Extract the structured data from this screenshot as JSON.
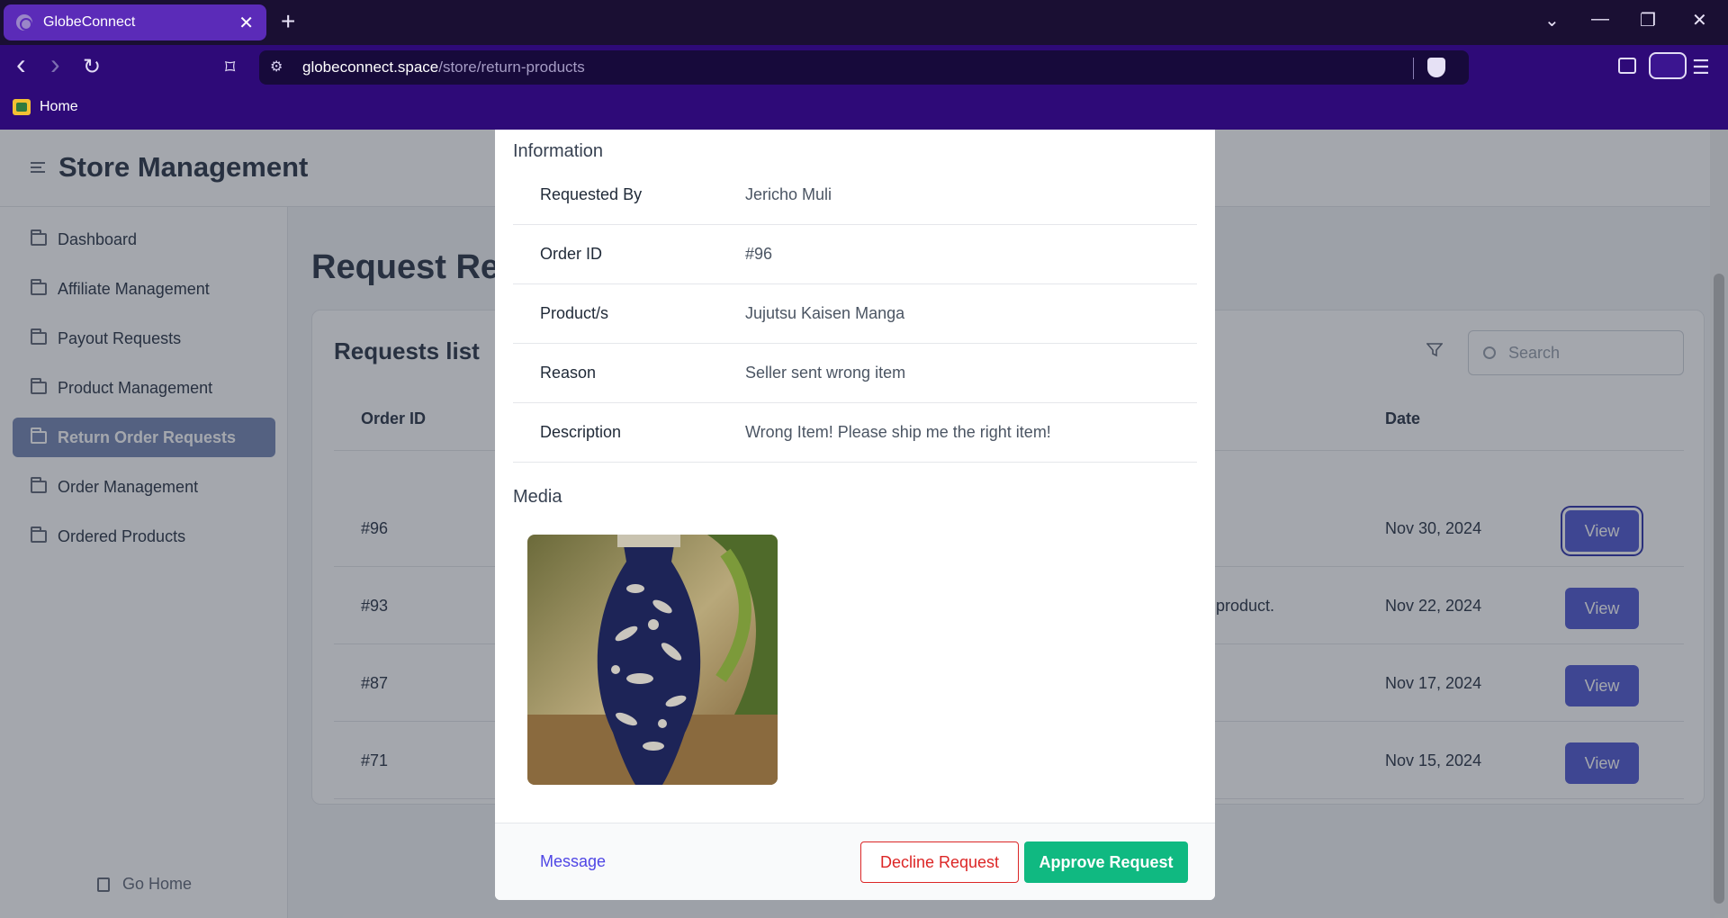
{
  "browser": {
    "tab_title": "GlobeConnect",
    "tab_close": "✕",
    "new_tab": "+",
    "url_host": "globeconnect.space",
    "url_path": "/store/return-products",
    "bookmark_home": "Home",
    "win_dropdown": "⌄",
    "win_minimize": "—",
    "win_restore": "❐",
    "win_close": "✕",
    "nav_back": "‹",
    "nav_forward": "›",
    "nav_reload": "↻",
    "bookmark_icon": "⌑",
    "menu_icon": "☰"
  },
  "app": {
    "title": "Store Management",
    "page_title": "Request Ret",
    "sidebar": {
      "items": [
        {
          "label": "Dashboard"
        },
        {
          "label": "Affiliate Management"
        },
        {
          "label": "Payout Requests"
        },
        {
          "label": "Product Management"
        },
        {
          "label": "Return Order Requests",
          "active": true
        },
        {
          "label": "Order Management"
        },
        {
          "label": "Ordered Products"
        }
      ],
      "go_home": "Go Home"
    },
    "requests_card": {
      "title": "Requests list",
      "search_placeholder": "Search",
      "columns": {
        "order_id": "Order ID",
        "date": "Date"
      },
      "rows": [
        {
          "order_id": "#96",
          "partial": "",
          "date": "Nov 30, 2024",
          "action": "View"
        },
        {
          "order_id": "#93",
          "partial": "product.",
          "date": "Nov 22, 2024",
          "action": "View"
        },
        {
          "order_id": "#87",
          "partial": "",
          "date": "Nov 17, 2024",
          "action": "View"
        },
        {
          "order_id": "#71",
          "partial": "",
          "date": "Nov 15, 2024",
          "action": "View"
        }
      ]
    }
  },
  "modal": {
    "information_title": "Information",
    "rows": [
      {
        "label": "Requested By",
        "value": "Jericho Muli"
      },
      {
        "label": "Order ID",
        "value": "#96"
      },
      {
        "label": "Product/s",
        "value": "Jujutsu Kaisen Manga"
      },
      {
        "label": "Reason",
        "value": "Seller sent wrong item"
      },
      {
        "label": "Description",
        "value": "Wrong Item! Please ship me the right item!"
      }
    ],
    "media_title": "Media",
    "footer": {
      "message": "Message",
      "decline": "Decline Request",
      "approve": "Approve Request"
    }
  },
  "colors": {
    "browser_tabbar": "#1a0f33",
    "browser_toolbar": "#2e0a78",
    "active_tab": "#5b2bb8",
    "sidebar_active": "#7e8fb9",
    "view_button": "#5b63d3",
    "approve_button": "#10b981",
    "decline_border": "#dc2626",
    "message_link": "#4f46e5"
  }
}
